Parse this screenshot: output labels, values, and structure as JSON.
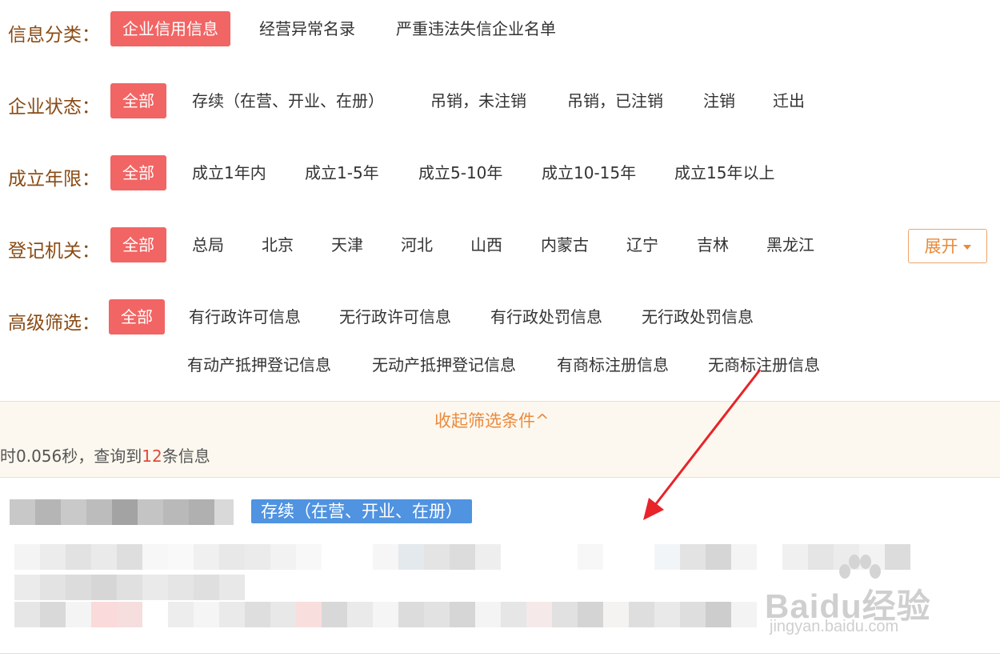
{
  "filters": {
    "info_category": {
      "label": "信息分类：",
      "options": [
        "企业信用信息",
        "经营异常名录",
        "严重违法失信企业名单"
      ],
      "active": "企业信用信息"
    },
    "company_status": {
      "label": "企业状态：",
      "options": [
        "全部",
        "存续（在营、开业、在册）",
        "吊销，未注销",
        "吊销，已注销",
        "注销",
        "迁出"
      ],
      "active": "全部"
    },
    "established_years": {
      "label": "成立年限：",
      "options": [
        "全部",
        "成立1年内",
        "成立1-5年",
        "成立5-10年",
        "成立10-15年",
        "成立15年以上"
      ],
      "active": "全部"
    },
    "registration_authority": {
      "label": "登记机关：",
      "options": [
        "全部",
        "总局",
        "北京",
        "天津",
        "河北",
        "山西",
        "内蒙古",
        "辽宁",
        "吉林",
        "黑龙江"
      ],
      "active": "全部",
      "expand_label": "展开"
    },
    "advanced": {
      "label": "高级筛选：",
      "options_row1": [
        "全部",
        "有行政许可信息",
        "无行政许可信息",
        "有行政处罚信息",
        "无行政处罚信息"
      ],
      "options_row2": [
        "有动产抵押登记信息",
        "无动产抵押登记信息",
        "有商标注册信息",
        "无商标注册信息"
      ],
      "active": "全部"
    }
  },
  "collapse_label": "收起筛选条件^",
  "stats": {
    "prefix": "时0.056秒，查询到",
    "count": "12",
    "suffix": "条信息"
  },
  "result": {
    "status_badge": "存续（在营、开业、在册）"
  },
  "watermark": {
    "logo_text": "Baidu经验",
    "url": "jingyan.baidu.com"
  },
  "colors": {
    "active_chip": "#f16564",
    "label": "#8a4b14",
    "accent_orange": "#eb8a3d",
    "badge_blue": "#4f93e1",
    "arrow": "#e8232a"
  }
}
